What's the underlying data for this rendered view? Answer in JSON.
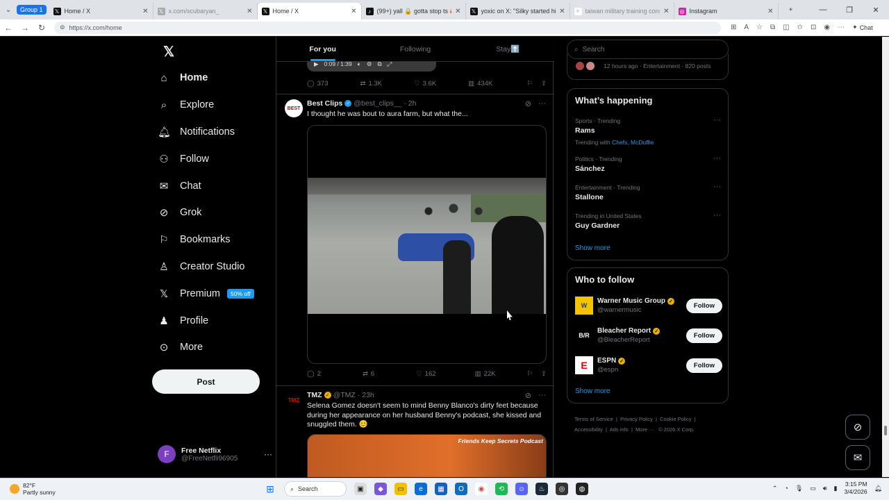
{
  "browser": {
    "group_label": "Group 1",
    "tabs": [
      {
        "title": "Home / X",
        "icon": "x-logo-icon"
      },
      {
        "title": "x.com/scubaryan_",
        "icon": "x-logo-icon"
      },
      {
        "title": "Home / X",
        "icon": "x-logo-icon",
        "active": true
      },
      {
        "title": "(99+) yall 🔒 gotta stop ts 🥰🥰",
        "icon": "tiktok-icon"
      },
      {
        "title": "yoxic on X: \"Silky started his stre",
        "icon": "x-logo-icon"
      },
      {
        "title": "taiwan military training consist",
        "icon": "search-icon"
      },
      {
        "title": "Instagram",
        "icon": "instagram-icon"
      }
    ],
    "url": "https://x.com/home",
    "chat_label": "Chat"
  },
  "sidebar": {
    "items": [
      {
        "label": "Home",
        "icon": "home-icon"
      },
      {
        "label": "Explore",
        "icon": "search-icon"
      },
      {
        "label": "Notifications",
        "icon": "bell-icon"
      },
      {
        "label": "Follow",
        "icon": "follow-icon"
      },
      {
        "label": "Chat",
        "icon": "mail-icon"
      },
      {
        "label": "Grok",
        "icon": "grok-icon"
      },
      {
        "label": "Bookmarks",
        "icon": "bookmark-icon"
      },
      {
        "label": "Creator Studio",
        "icon": "creator-icon"
      },
      {
        "label": "Premium",
        "icon": "x-logo-icon",
        "badge": "50% off"
      },
      {
        "label": "Profile",
        "icon": "person-icon"
      },
      {
        "label": "More",
        "icon": "more-circle-icon"
      }
    ],
    "post_label": "Post",
    "account": {
      "initial": "F",
      "name": "Free Netflix",
      "handle": "@FreeNetfli96905"
    }
  },
  "feed": {
    "tabs": [
      "For you",
      "Following",
      "Stay⬆️"
    ],
    "player_time": "0:09 / 1:39",
    "prev_actions": {
      "replies": "373",
      "reposts": "1.3K",
      "likes": "3.6K",
      "views": "434K"
    },
    "posts": [
      {
        "name": "Best Clips",
        "handle": "@best_clips__",
        "time": "· 2h",
        "avatar_text": "BEST",
        "text": "I thought he was bout to aura farm, but what the...",
        "actions": {
          "replies": "2",
          "reposts": "6",
          "likes": "162",
          "views": "22K"
        }
      },
      {
        "name": "TMZ",
        "handle": "@TMZ",
        "time": "· 23h",
        "avatar_text": "TMZ",
        "text": "Selena Gomez doesn't seem to mind Benny Blanco's dirty feet because during her appearance on her husband Benny's podcast, she kissed and snuggled them. 😊",
        "media_caption": "Friends Keep Secrets Podcast"
      }
    ]
  },
  "right": {
    "search_placeholder": "Search",
    "top_meta": "12 hours ago · Entertainment · 820 posts",
    "happening_title": "What’s happening",
    "trends": [
      {
        "category": "Sports · Trending",
        "name": "Rams",
        "with_label": "Trending with",
        "with_links": "Chefs, McDuffie"
      },
      {
        "category": "Politics · Trending",
        "name": "Sánchez"
      },
      {
        "category": "Entertainment · Trending",
        "name": "Stallone"
      },
      {
        "category": "Trending in United States",
        "name": "Guy Gardner"
      }
    ],
    "show_more": "Show more",
    "who_title": "Who to follow",
    "who": [
      {
        "name": "Warner Music Group",
        "handle": "@warnermusic",
        "logo": "W"
      },
      {
        "name": "Bleacher Report",
        "handle": "@BleacherReport",
        "logo": "B/R"
      },
      {
        "name": "ESPN",
        "handle": "@espn",
        "logo": "E"
      }
    ],
    "follow_label": "Follow",
    "footer_links": [
      "Terms of Service",
      "Privacy Policy",
      "Cookie Policy",
      "Accessibility",
      "Ads info",
      "More ···",
      "© 2026 X Corp."
    ]
  },
  "taskbar": {
    "temp": "82°F",
    "weather": "Partly sunny",
    "search_label": "Search",
    "time": "3:15 PM",
    "date": "3/4/2026"
  }
}
